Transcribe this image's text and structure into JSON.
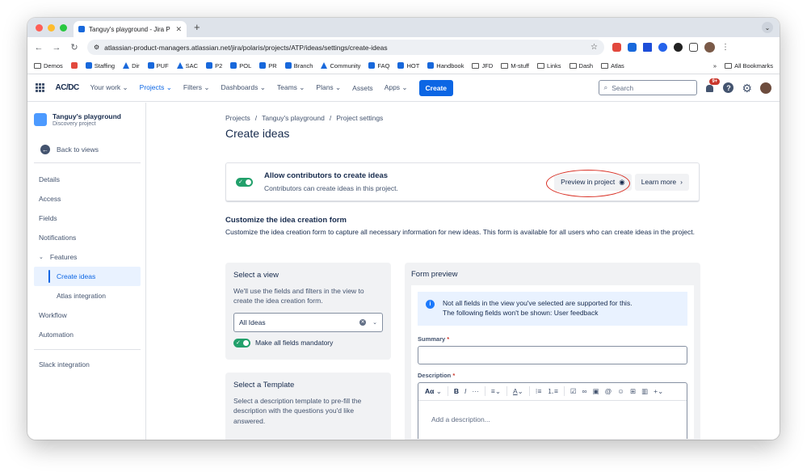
{
  "browser": {
    "tab_title": "Tanguy's playground - Jira P",
    "url": "atlassian-product-managers.atlassian.net/jira/polaris/projects/ATP/ideas/settings/create-ideas",
    "bookmarks": [
      {
        "label": "Demos",
        "icon": "folder-icon"
      },
      {
        "label": "",
        "icon": "red-app-icon"
      },
      {
        "label": "Staffing",
        "icon": "jira-icon"
      },
      {
        "label": "Dir",
        "icon": "atlassian-icon"
      },
      {
        "label": "PUF",
        "icon": "jira-icon"
      },
      {
        "label": "SAC",
        "icon": "atlassian-icon"
      },
      {
        "label": "P2",
        "icon": "jira-icon"
      },
      {
        "label": "POL",
        "icon": "jira-icon"
      },
      {
        "label": "PR",
        "icon": "jira-icon"
      },
      {
        "label": "Branch",
        "icon": "jira-icon"
      },
      {
        "label": "Community",
        "icon": "atlassian-icon"
      },
      {
        "label": "FAQ",
        "icon": "jira-icon"
      },
      {
        "label": "HOT",
        "icon": "jira-icon"
      },
      {
        "label": "Handbook",
        "icon": "jira-icon"
      },
      {
        "label": "JFD",
        "icon": "folder-icon"
      },
      {
        "label": "M-stuff",
        "icon": "folder-icon"
      },
      {
        "label": "Links",
        "icon": "folder-icon"
      },
      {
        "label": "Dash",
        "icon": "folder-icon"
      },
      {
        "label": "Atlas",
        "icon": "folder-icon"
      }
    ],
    "more_bookmarks": "»",
    "all_bookmarks": "All Bookmarks"
  },
  "jira_nav": {
    "logo": "AC/DC",
    "items": [
      {
        "label": "Your work",
        "name": "your-work",
        "active": false
      },
      {
        "label": "Projects",
        "name": "projects",
        "active": true
      },
      {
        "label": "Filters",
        "name": "filters",
        "active": false
      },
      {
        "label": "Dashboards",
        "name": "dashboards",
        "active": false
      },
      {
        "label": "Teams",
        "name": "teams",
        "active": false
      },
      {
        "label": "Plans",
        "name": "plans",
        "active": false
      }
    ],
    "assets": "Assets",
    "apps": "Apps",
    "create": "Create",
    "search_placeholder": "Search",
    "notifications_badge": "9+"
  },
  "sidebar": {
    "project_name": "Tanguy's playground",
    "project_type": "Discovery project",
    "back": "Back to views",
    "items": [
      {
        "label": "Details",
        "name": "details"
      },
      {
        "label": "Access",
        "name": "access"
      },
      {
        "label": "Fields",
        "name": "fields"
      },
      {
        "label": "Notifications",
        "name": "notifications"
      }
    ],
    "features": "Features",
    "sub_items": [
      {
        "label": "Create ideas",
        "name": "create-ideas",
        "active": true
      },
      {
        "label": "Atlas integration",
        "name": "atlas-integration",
        "active": false
      }
    ],
    "items_after": [
      {
        "label": "Workflow",
        "name": "workflow"
      },
      {
        "label": "Automation",
        "name": "automation"
      }
    ],
    "slack": "Slack integration"
  },
  "page": {
    "breadcrumbs": [
      "Projects",
      "Tanguy's playground",
      "Project settings"
    ],
    "title": "Create ideas",
    "allow_title": "Allow contributors to create ideas",
    "allow_sub": "Contributors can create ideas in this project.",
    "allow_enabled": true,
    "preview_btn": "Preview in project",
    "learn_more_btn": "Learn more",
    "section_title": "Customize the idea creation form",
    "section_desc": "Customize the idea creation form to capture all necessary information for new ideas. This form is available for all users who can create ideas in the project.",
    "select_view_title": "Select a view",
    "select_view_desc": "We'll use the fields and filters in the view to create the idea creation form.",
    "selected_view": "All Ideas",
    "mandatory_label": "Make all fields mandatory",
    "mandatory_enabled": true,
    "template_title": "Select a Template",
    "template_desc": "Select a description template to pre-fill the description with the questions you'd like answered.",
    "preview_title": "Form preview",
    "info_line1": "Not all fields in the view you've selected are supported for this.",
    "info_line2": "The following fields won't be shown: User feedback",
    "summary_label": "Summary",
    "description_label": "Description",
    "required_mark": "*",
    "editor_text_style": "Aα",
    "editor_placeholder": "Add a description..."
  }
}
